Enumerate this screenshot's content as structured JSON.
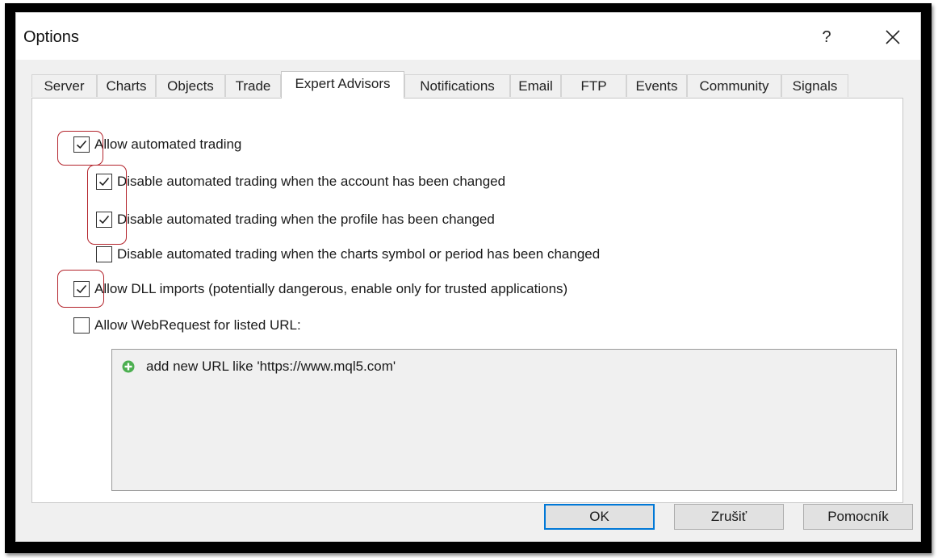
{
  "window": {
    "title": "Options",
    "help_glyph": "?",
    "close_icon": "close-icon"
  },
  "tabs": [
    {
      "label": "Server"
    },
    {
      "label": "Charts"
    },
    {
      "label": "Objects"
    },
    {
      "label": "Trade"
    },
    {
      "label": "Expert Advisors",
      "active": true
    },
    {
      "label": "Notifications"
    },
    {
      "label": "Email"
    },
    {
      "label": "FTP"
    },
    {
      "label": "Events"
    },
    {
      "label": "Community"
    },
    {
      "label": "Signals"
    }
  ],
  "options": {
    "allow_automated": {
      "label": "Allow automated trading",
      "checked": true
    },
    "disable_account": {
      "label": "Disable automated trading when the account has been changed",
      "checked": true
    },
    "disable_profile": {
      "label": "Disable automated trading when the profile has been changed",
      "checked": true
    },
    "disable_symbol": {
      "label": "Disable automated trading when the charts symbol or period has been changed",
      "checked": false
    },
    "allow_dll": {
      "label": "Allow DLL imports (potentially dangerous, enable only for trusted applications)",
      "checked": true
    },
    "allow_webrequest": {
      "label": "Allow WebRequest for listed URL:",
      "checked": false
    }
  },
  "url_list": {
    "add_hint": "add new URL like 'https://www.mql5.com'",
    "add_icon": "add-icon"
  },
  "buttons": {
    "ok": "OK",
    "cancel": "Zrušiť",
    "help": "Pomocník"
  },
  "colors": {
    "highlight_marks": "#b3232b",
    "default_button_border": "#0078d7",
    "add_icon": "#4caf50"
  }
}
